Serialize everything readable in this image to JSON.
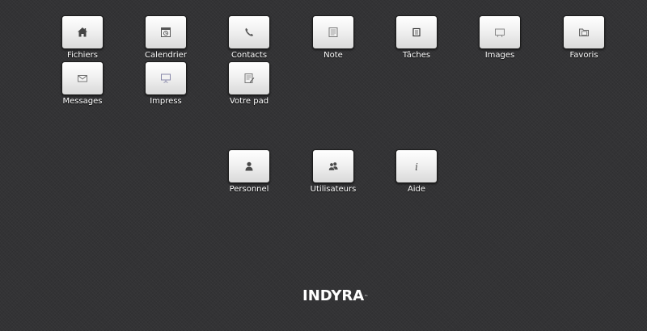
{
  "apps": {
    "fichiers": {
      "label": "Fichiers",
      "icon": "home-icon"
    },
    "calendrier": {
      "label": "Calendrier",
      "icon": "calendar-icon"
    },
    "contacts": {
      "label": "Contacts",
      "icon": "phone-icon"
    },
    "note": {
      "label": "Note",
      "icon": "note-icon"
    },
    "taches": {
      "label": "Tâches",
      "icon": "tasks-icon"
    },
    "images": {
      "label": "Images",
      "icon": "image-icon"
    },
    "favoris": {
      "label": "Favoris",
      "icon": "folder-icon"
    },
    "messages": {
      "label": "Messages",
      "icon": "envelope-icon"
    },
    "impress": {
      "label": "Impress",
      "icon": "presentation-icon"
    },
    "votre_pad": {
      "label": "Votre pad",
      "icon": "pad-icon"
    },
    "personnel": {
      "label": "Personnel",
      "icon": "user-icon"
    },
    "utilisateurs": {
      "label": "Utilisateurs",
      "icon": "users-icon"
    },
    "aide": {
      "label": "Aide",
      "icon": "info-icon"
    }
  },
  "footer": {
    "logo_text": "INDYRA",
    "logo_mark": "™"
  }
}
